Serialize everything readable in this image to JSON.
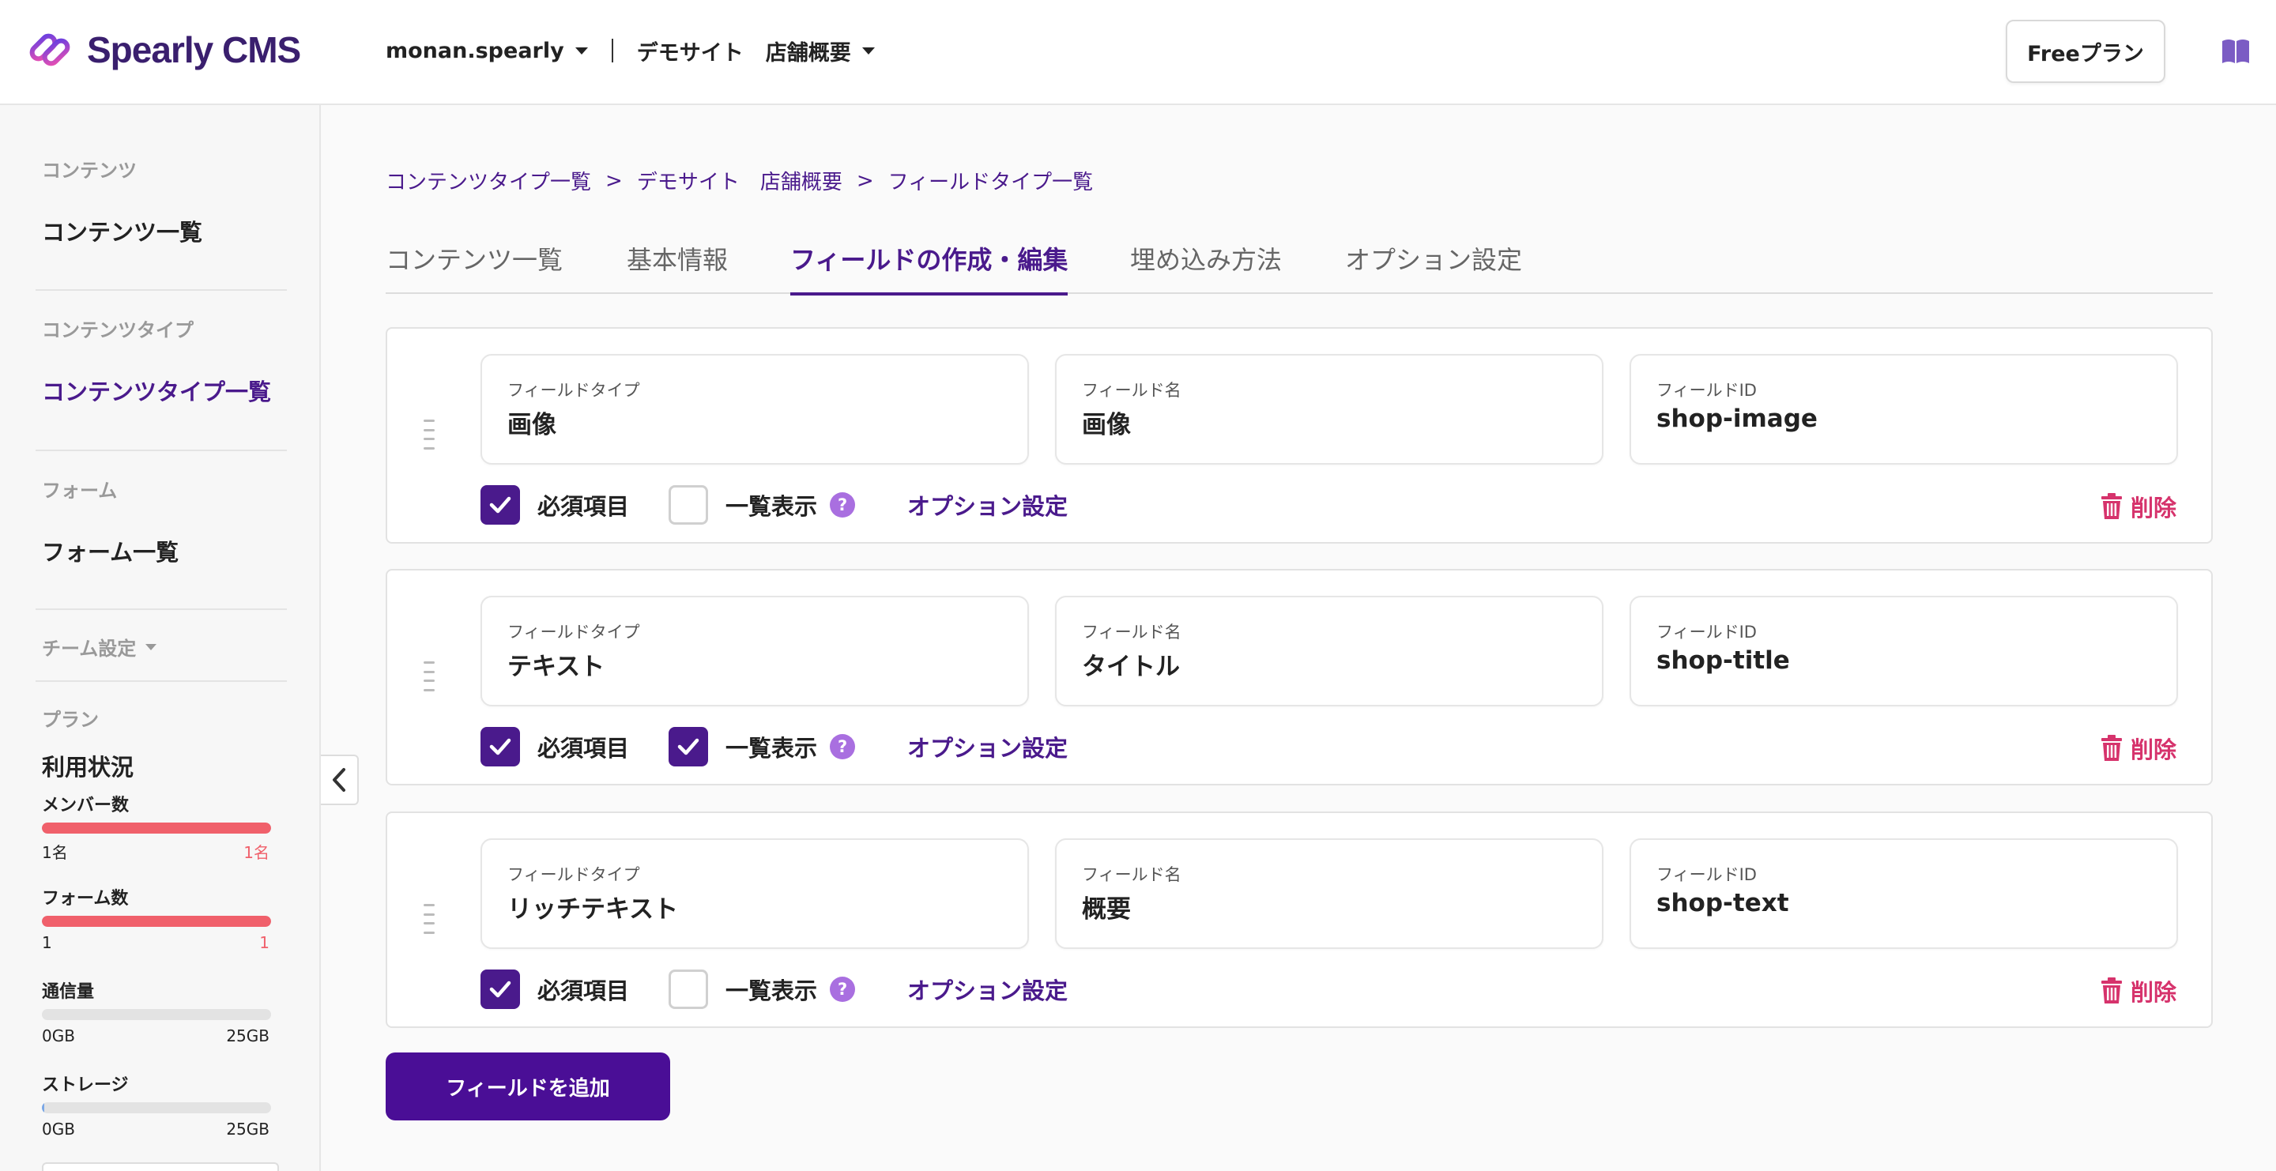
{
  "app": {
    "name": "Spearly CMS"
  },
  "header": {
    "workspace": "monan.spearly",
    "site": "デモサイト",
    "content_type": "店舗概要",
    "plan_button": "Freeプラン"
  },
  "sidebar": {
    "content_section": "コンテンツ",
    "content_list": "コンテンツ一覧",
    "ctype_section": "コンテンツタイプ",
    "ctype_list": "コンテンツタイプ一覧",
    "form_section": "フォーム",
    "form_list": "フォーム一覧",
    "team_settings": "チーム設定",
    "plan_section": "プラン",
    "usage_title": "利用状況",
    "meters": [
      {
        "label": "メンバー数",
        "min": "1名",
        "max": "1名",
        "fraction": 1.0,
        "color": "#f0606b",
        "full": true
      },
      {
        "label": "フォーム数",
        "min": "1",
        "max": "1",
        "fraction": 1.0,
        "color": "#f0606b",
        "full": true
      },
      {
        "label": "通信量",
        "min": "0GB",
        "max": "25GB",
        "fraction": 0.0,
        "color": "#7aa7e6",
        "full": false
      },
      {
        "label": "ストレージ",
        "min": "0GB",
        "max": "25GB",
        "fraction": 0.005,
        "color": "#7aa7e6",
        "full": false
      }
    ]
  },
  "breadcrumb": {
    "items": [
      "コンテンツタイプ一覧",
      "デモサイト　店舗概要",
      "フィールドタイプ一覧"
    ],
    "separator": ">"
  },
  "tabs": [
    "コンテンツ一覧",
    "基本情報",
    "フィールドの作成・編集",
    "埋め込み方法",
    "オプション設定"
  ],
  "active_tab": 2,
  "labels": {
    "field_type": "フィールドタイプ",
    "field_name": "フィールド名",
    "field_id": "フィールドID",
    "required": "必須項目",
    "list_display": "一覧表示",
    "help": "?",
    "option_settings": "オプション設定",
    "delete": "削除"
  },
  "fields": [
    {
      "type": "画像",
      "name": "画像",
      "id": "shop-image",
      "required": true,
      "list_display": false
    },
    {
      "type": "テキスト",
      "name": "タイトル",
      "id": "shop-title",
      "required": true,
      "list_display": true
    },
    {
      "type": "リッチテキスト",
      "name": "概要",
      "id": "shop-text",
      "required": true,
      "list_display": false
    }
  ],
  "add_field_button": "フィールドを追加",
  "colors": {
    "brand": "#4a1a8c",
    "danger": "#d6336c",
    "help": "#a96fe0"
  }
}
